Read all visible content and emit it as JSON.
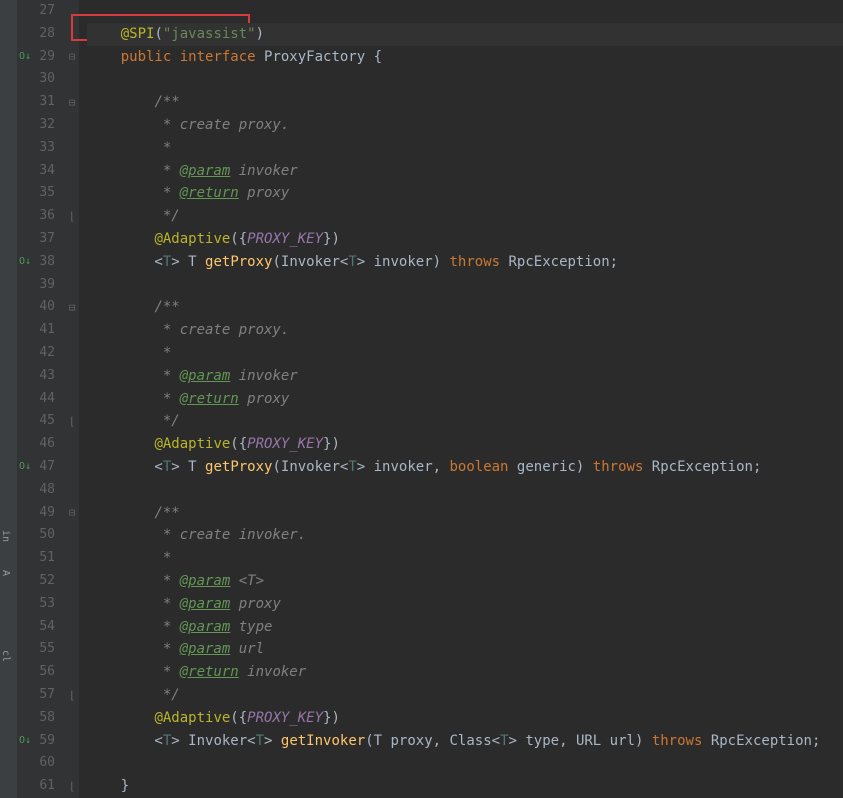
{
  "lines": [
    {
      "num": "27",
      "fold": "",
      "code": ""
    },
    {
      "num": "28",
      "fold": "",
      "hl": true,
      "redbox": true,
      "tokens": [
        {
          "t": "    ",
          "c": ""
        },
        {
          "t": "@SPI",
          "c": "annotation"
        },
        {
          "t": "(",
          "c": "paren"
        },
        {
          "t": "\"javassist\"",
          "c": "string"
        },
        {
          "t": ")",
          "c": "paren"
        }
      ]
    },
    {
      "num": "29",
      "fold": "minus",
      "ind": "O↓",
      "tokens": [
        {
          "t": "    ",
          "c": ""
        },
        {
          "t": "public",
          "c": "kw"
        },
        {
          "t": " ",
          "c": ""
        },
        {
          "t": "interface",
          "c": "kw"
        },
        {
          "t": " ProxyFactory {",
          "c": "ident"
        }
      ]
    },
    {
      "num": "30",
      "fold": "",
      "tokens": []
    },
    {
      "num": "31",
      "fold": "minus",
      "tokens": [
        {
          "t": "        ",
          "c": ""
        },
        {
          "t": "/**",
          "c": "comment"
        }
      ]
    },
    {
      "num": "32",
      "fold": "",
      "tokens": [
        {
          "t": "         * create proxy.",
          "c": "comment"
        }
      ]
    },
    {
      "num": "33",
      "fold": "",
      "tokens": [
        {
          "t": "         *",
          "c": "comment"
        }
      ]
    },
    {
      "num": "34",
      "fold": "",
      "tokens": [
        {
          "t": "         * ",
          "c": "comment"
        },
        {
          "t": "@param",
          "c": "doc-tag"
        },
        {
          "t": " invoker",
          "c": "comment"
        }
      ]
    },
    {
      "num": "35",
      "fold": "",
      "tokens": [
        {
          "t": "         * ",
          "c": "comment"
        },
        {
          "t": "@return",
          "c": "doc-tag"
        },
        {
          "t": " proxy",
          "c": "comment"
        }
      ]
    },
    {
      "num": "36",
      "fold": "bracket",
      "tokens": [
        {
          "t": "         */",
          "c": "comment"
        }
      ]
    },
    {
      "num": "37",
      "fold": "",
      "tokens": [
        {
          "t": "        ",
          "c": ""
        },
        {
          "t": "@Adaptive",
          "c": "annotation"
        },
        {
          "t": "({",
          "c": "paren"
        },
        {
          "t": "PROXY_KEY",
          "c": "const"
        },
        {
          "t": "})",
          "c": "paren"
        }
      ]
    },
    {
      "num": "38",
      "fold": "",
      "ind": "O↓",
      "tokens": [
        {
          "t": "        <",
          "c": "paren"
        },
        {
          "t": "T",
          "c": "generic"
        },
        {
          "t": "> ",
          "c": "paren"
        },
        {
          "t": "T",
          "c": "ident"
        },
        {
          "t": " ",
          "c": ""
        },
        {
          "t": "getProxy",
          "c": "method-decl"
        },
        {
          "t": "(Invoker<",
          "c": "paren"
        },
        {
          "t": "T",
          "c": "generic"
        },
        {
          "t": "> invoker) ",
          "c": "paren"
        },
        {
          "t": "throws",
          "c": "kw"
        },
        {
          "t": " RpcException;",
          "c": "ident"
        }
      ]
    },
    {
      "num": "39",
      "fold": "",
      "tokens": []
    },
    {
      "num": "40",
      "fold": "minus",
      "tokens": [
        {
          "t": "        ",
          "c": ""
        },
        {
          "t": "/**",
          "c": "comment"
        }
      ]
    },
    {
      "num": "41",
      "fold": "",
      "tokens": [
        {
          "t": "         * create proxy.",
          "c": "comment"
        }
      ]
    },
    {
      "num": "42",
      "fold": "",
      "tokens": [
        {
          "t": "         *",
          "c": "comment"
        }
      ]
    },
    {
      "num": "43",
      "fold": "",
      "tokens": [
        {
          "t": "         * ",
          "c": "comment"
        },
        {
          "t": "@param",
          "c": "doc-tag"
        },
        {
          "t": " invoker",
          "c": "comment"
        }
      ]
    },
    {
      "num": "44",
      "fold": "",
      "tokens": [
        {
          "t": "         * ",
          "c": "comment"
        },
        {
          "t": "@return",
          "c": "doc-tag"
        },
        {
          "t": " proxy",
          "c": "comment"
        }
      ]
    },
    {
      "num": "45",
      "fold": "bracket",
      "tokens": [
        {
          "t": "         */",
          "c": "comment"
        }
      ]
    },
    {
      "num": "46",
      "fold": "",
      "tokens": [
        {
          "t": "        ",
          "c": ""
        },
        {
          "t": "@Adaptive",
          "c": "annotation"
        },
        {
          "t": "({",
          "c": "paren"
        },
        {
          "t": "PROXY_KEY",
          "c": "const"
        },
        {
          "t": "})",
          "c": "paren"
        }
      ]
    },
    {
      "num": "47",
      "fold": "",
      "ind": "O↓",
      "tokens": [
        {
          "t": "        <",
          "c": "paren"
        },
        {
          "t": "T",
          "c": "generic"
        },
        {
          "t": "> ",
          "c": "paren"
        },
        {
          "t": "T",
          "c": "ident"
        },
        {
          "t": " ",
          "c": ""
        },
        {
          "t": "getProxy",
          "c": "method-decl"
        },
        {
          "t": "(Invoker<",
          "c": "paren"
        },
        {
          "t": "T",
          "c": "generic"
        },
        {
          "t": "> invoker, ",
          "c": "paren"
        },
        {
          "t": "boolean",
          "c": "kw"
        },
        {
          "t": " generic) ",
          "c": "ident"
        },
        {
          "t": "throws",
          "c": "kw"
        },
        {
          "t": " RpcException;",
          "c": "ident"
        }
      ]
    },
    {
      "num": "48",
      "fold": "",
      "tokens": []
    },
    {
      "num": "49",
      "fold": "minus",
      "tokens": [
        {
          "t": "        ",
          "c": ""
        },
        {
          "t": "/**",
          "c": "comment"
        }
      ]
    },
    {
      "num": "50",
      "fold": "",
      "tokens": [
        {
          "t": "         * create invoker.",
          "c": "comment"
        }
      ]
    },
    {
      "num": "51",
      "fold": "",
      "tokens": [
        {
          "t": "         *",
          "c": "comment"
        }
      ]
    },
    {
      "num": "52",
      "fold": "",
      "tokens": [
        {
          "t": "         * ",
          "c": "comment"
        },
        {
          "t": "@param",
          "c": "doc-tag"
        },
        {
          "t": " <T>",
          "c": "comment"
        }
      ]
    },
    {
      "num": "53",
      "fold": "",
      "tokens": [
        {
          "t": "         * ",
          "c": "comment"
        },
        {
          "t": "@param",
          "c": "doc-tag"
        },
        {
          "t": " proxy",
          "c": "comment"
        }
      ]
    },
    {
      "num": "54",
      "fold": "",
      "tokens": [
        {
          "t": "         * ",
          "c": "comment"
        },
        {
          "t": "@param",
          "c": "doc-tag"
        },
        {
          "t": " type",
          "c": "comment"
        }
      ]
    },
    {
      "num": "55",
      "fold": "",
      "tokens": [
        {
          "t": "         * ",
          "c": "comment"
        },
        {
          "t": "@param",
          "c": "doc-tag"
        },
        {
          "t": " url",
          "c": "comment"
        }
      ]
    },
    {
      "num": "56",
      "fold": "",
      "tokens": [
        {
          "t": "         * ",
          "c": "comment"
        },
        {
          "t": "@return",
          "c": "doc-tag"
        },
        {
          "t": " invoker",
          "c": "comment"
        }
      ]
    },
    {
      "num": "57",
      "fold": "bracket",
      "tokens": [
        {
          "t": "         */",
          "c": "comment"
        }
      ]
    },
    {
      "num": "58",
      "fold": "",
      "tokens": [
        {
          "t": "        ",
          "c": ""
        },
        {
          "t": "@Adaptive",
          "c": "annotation"
        },
        {
          "t": "({",
          "c": "paren"
        },
        {
          "t": "PROXY_KEY",
          "c": "const"
        },
        {
          "t": "})",
          "c": "paren"
        }
      ]
    },
    {
      "num": "59",
      "fold": "",
      "ind": "O↓",
      "tokens": [
        {
          "t": "        <",
          "c": "paren"
        },
        {
          "t": "T",
          "c": "generic"
        },
        {
          "t": "> Invoker<",
          "c": "paren"
        },
        {
          "t": "T",
          "c": "generic"
        },
        {
          "t": "> ",
          "c": "paren"
        },
        {
          "t": "getInvoker",
          "c": "method-decl"
        },
        {
          "t": "(",
          "c": "paren"
        },
        {
          "t": "T",
          "c": "ident"
        },
        {
          "t": " proxy, Class<",
          "c": "paren"
        },
        {
          "t": "T",
          "c": "generic"
        },
        {
          "t": "> type, URL url) ",
          "c": "paren"
        },
        {
          "t": "throws",
          "c": "kw"
        },
        {
          "t": " RpcException;",
          "c": "ident"
        }
      ]
    },
    {
      "num": "60",
      "fold": "",
      "tokens": []
    },
    {
      "num": "61",
      "fold": "bracket",
      "tokens": [
        {
          "t": "    }",
          "c": "ident"
        }
      ]
    }
  ],
  "leftLabels": [
    "in",
    "A",
    "cl"
  ]
}
